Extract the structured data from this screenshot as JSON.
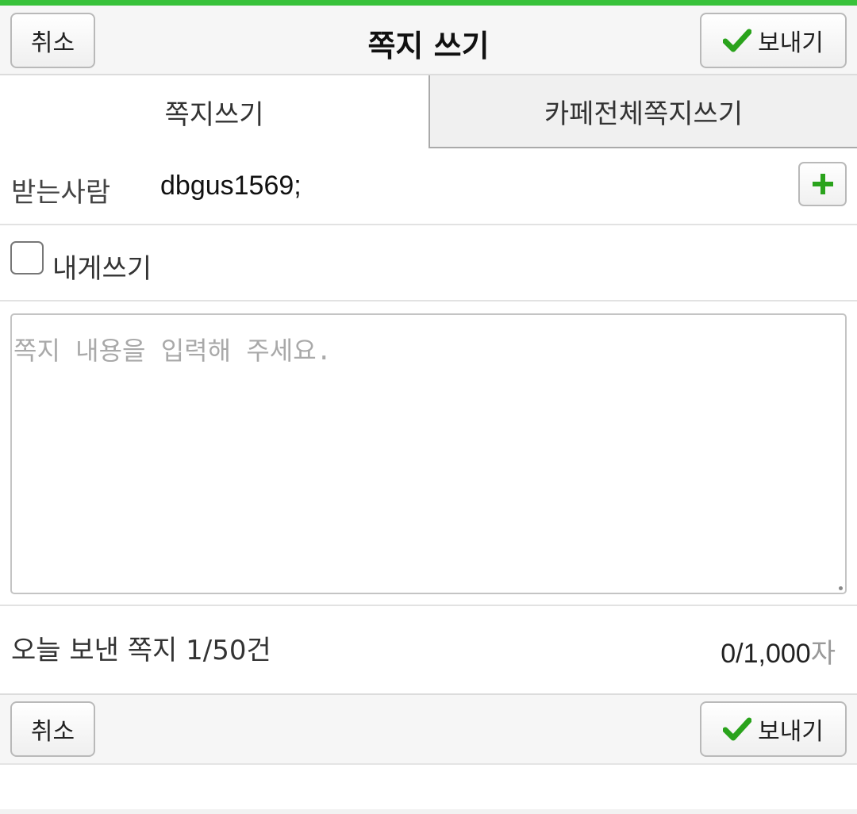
{
  "header": {
    "title": "쪽지 쓰기",
    "cancel_label": "취소",
    "send_label": "보내기"
  },
  "tabs": [
    {
      "label": "쪽지쓰기",
      "active": true
    },
    {
      "label": "카페전체쪽지쓰기",
      "active": false
    }
  ],
  "recipient": {
    "label": "받는사람",
    "value": "dbgus1569;"
  },
  "self_message": {
    "label": "내게쓰기",
    "checked": false
  },
  "message": {
    "placeholder": "쪽지 내용을 입력해 주세요.",
    "value": ""
  },
  "counters": {
    "today_sent": "오늘 보낸 쪽지 1/50건",
    "char_count": "0/1,000",
    "char_unit": "자"
  },
  "footer": {
    "cancel_label": "취소",
    "send_label": "보내기"
  },
  "colors": {
    "accent_green": "#38c23a",
    "check_green": "#2aa31c"
  }
}
